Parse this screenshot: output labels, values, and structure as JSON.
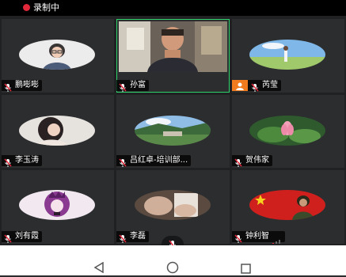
{
  "status": {
    "recording_label": "录制中"
  },
  "participants": [
    {
      "name": "鹏嘭嘭",
      "type": "avatar",
      "avatar": "woman-glasses"
    },
    {
      "name": "孙富",
      "type": "video",
      "active": true
    },
    {
      "name": "芮莹",
      "type": "avatar",
      "host": true,
      "avatar": "field-sky"
    },
    {
      "name": "李玉涛",
      "type": "avatar",
      "avatar": "woman-portrait"
    },
    {
      "name": "吕红卓-培训部...",
      "type": "avatar",
      "avatar": "landscape-dam"
    },
    {
      "name": "贺伟家",
      "type": "avatar",
      "avatar": "lotus"
    },
    {
      "name": "刘有霞",
      "type": "avatar",
      "avatar": "purple-anime"
    },
    {
      "name": "李磊",
      "type": "avatar",
      "avatar": "hands-photo"
    },
    {
      "name": "钟利智",
      "type": "avatar",
      "avatar": "flag-soldier"
    }
  ],
  "colors": {
    "active_border": "#2fd36b",
    "host_badge": "#f07a1e",
    "recording_dot": "#e0283a",
    "tile_bg": "#2c2d2f"
  },
  "navigation": {
    "back": "back-triangle-icon",
    "home": "home-circle-icon",
    "recents": "recents-square-icon"
  }
}
